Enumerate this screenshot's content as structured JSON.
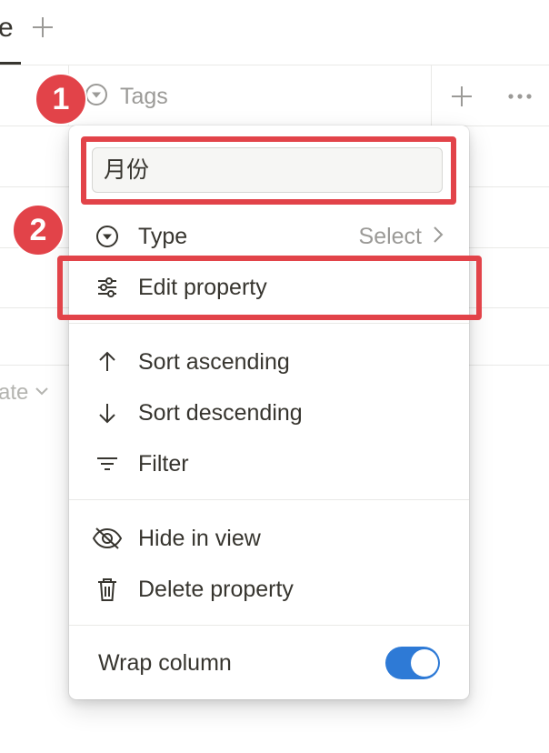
{
  "tab": {
    "fragment": "e"
  },
  "header": {
    "property_name": "Tags"
  },
  "table": {
    "cell_fragment": "ate"
  },
  "menu": {
    "name_input_value": "月份",
    "type": {
      "label": "Type",
      "value": "Select"
    },
    "edit_property": "Edit property",
    "sort_ascending": "Sort ascending",
    "sort_descending": "Sort descending",
    "filter": "Filter",
    "hide_in_view": "Hide in view",
    "delete_property": "Delete property",
    "wrap_column": "Wrap column",
    "wrap_column_enabled": true
  },
  "annotations": {
    "badge_1": "1",
    "badge_2": "2",
    "color": "#e24349"
  },
  "colors": {
    "accent": "#2e7ad6",
    "text": "#37352f",
    "muted": "#9b9a97"
  },
  "icons": [
    "plus-icon",
    "select-type-icon",
    "more-icon",
    "sliders-icon",
    "arrow-up-icon",
    "arrow-down-icon",
    "filter-icon",
    "eye-off-icon",
    "trash-icon",
    "chevron-right-icon",
    "chevron-down-icon"
  ]
}
